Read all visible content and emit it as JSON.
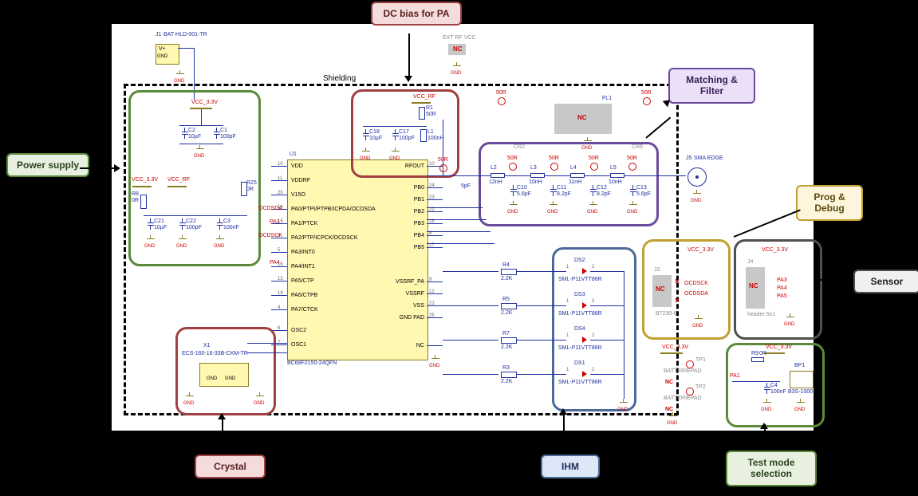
{
  "callouts": {
    "dc_bias": "DC bias for PA",
    "power_supply": "Power supply",
    "matching_filter": "Matching & Filter",
    "prog_debug": "Prog & Debug",
    "sensor": "Sensor",
    "crystal": "Crystal",
    "ihm": "IHM",
    "test_mode": "Test mode selection"
  },
  "labels": {
    "shielding": "Shielding",
    "j1": "J1",
    "j1_part": "BAT-HLD-001-TR",
    "vplus": "V+",
    "gnd": "GND",
    "vcc_33v": "VCC_3.3V",
    "vcc_rf": "VCC_RF",
    "ext_rf_vcc": "EXT RF VCC",
    "nc": "NC",
    "r1": "R1",
    "r1_val": "50R",
    "r8": "R8",
    "r8_val": "0R",
    "r25": "R25",
    "r25_val": "0R",
    "r4": "R4",
    "r5": "R5",
    "r7": "R7",
    "r3": "R3",
    "r_val_22k": "2.2K",
    "r9": "R9",
    "r9_val": "0R",
    "c1": "C1",
    "c1_val": "100pF",
    "c2": "C2",
    "c2_val": "10µF",
    "c3": "C3",
    "c3_val": "100nF",
    "c4": "C4",
    "c4_val": "100nF",
    "c17": "C17",
    "c17_val": "100pF",
    "c18": "C18",
    "c18_val": "10µF",
    "c21": "C21",
    "c21_val": "10µF",
    "c22": "C22",
    "c22_val": "100pF",
    "c10": "C10",
    "c10_val": "5.6pF",
    "c11": "C11",
    "c11_val": "8.2pF",
    "c12": "C12",
    "c12_val": "8.2pF",
    "c13": "C13",
    "c13_val": "5.6pF",
    "c_5pf": "5pF",
    "l1": "L1",
    "l1_val": "100nH",
    "l2": "L2",
    "l2_val": "12nH",
    "l3": "L3",
    "l3_val": "10nH",
    "l4": "L4",
    "l4_val": "11nH",
    "l5": "L5",
    "l5_val": "10nH",
    "fl1": "FL1",
    "j5": "J5",
    "j5_part": "SMA EDGE",
    "j3": "J3",
    "j3_part": "B7230-6",
    "j4": "J4",
    "j4_part": "header 5x1",
    "u1": "U1",
    "u1_part": "BC68F2150-24QFN",
    "x1": "X1",
    "x1_part": "ECS-160-16-33B-CKM-TR",
    "bp1": "BP1",
    "bp1_part": "B3S-1000",
    "ds1": "DS1",
    "ds2": "DS2",
    "ds3": "DS3",
    "ds4": "DS4",
    "ds_part": "SML-P11VTT86R",
    "tp1": "TP1",
    "tp2": "TP2",
    "tp_label": "BATTERIEPAD",
    "r50": "50R",
    "ocdsda": "OCDSDA",
    "ocdsck": "OCDSCK",
    "pa1": "PA1",
    "pa3": "PA3",
    "pa4": "PA4",
    "pa5": "PA5",
    "cr2": "CR2",
    "cr6": "CR6"
  },
  "u1_pins_left": [
    {
      "n": "10",
      "name": "VDD"
    },
    {
      "n": "11",
      "name": "VDDRF"
    },
    {
      "n": "20",
      "name": "V15O"
    },
    {
      "n": "14",
      "name": "PA0/PTPI/PTPB/ICPDA/OCDSDA"
    },
    {
      "n": "15",
      "name": "PA1/PTCK"
    },
    {
      "n": "3",
      "name": "PA2/PTP/ICPCK/OCDSCK"
    },
    {
      "n": "5",
      "name": "PA3/INT0"
    },
    {
      "n": "16",
      "name": "PA4/INT1"
    },
    {
      "n": "13",
      "name": "PA5/CTP"
    },
    {
      "n": "19",
      "name": "PA6/CTPB"
    },
    {
      "n": "4",
      "name": "PA7/CTCK"
    },
    {
      "n": "6",
      "name": "OSC2"
    },
    {
      "n": "7",
      "name": "OSC1"
    }
  ],
  "u1_pins_right": [
    {
      "n": "10",
      "name": "RFOUT"
    },
    {
      "n": "24",
      "name": "PB0"
    },
    {
      "n": "23",
      "name": "PB1"
    },
    {
      "n": "22",
      "name": "PB2"
    },
    {
      "n": "18",
      "name": "PB3"
    },
    {
      "n": "8",
      "name": "PB4"
    },
    {
      "n": "17",
      "name": "PB5"
    },
    {
      "n": "9",
      "name": "VSSRF_PA"
    },
    {
      "n": "12",
      "name": "VSSRF"
    },
    {
      "n": "21",
      "name": "VSS"
    },
    {
      "n": "25",
      "name": "GND PAD"
    },
    {
      "n": "",
      "name": "NC"
    }
  ]
}
